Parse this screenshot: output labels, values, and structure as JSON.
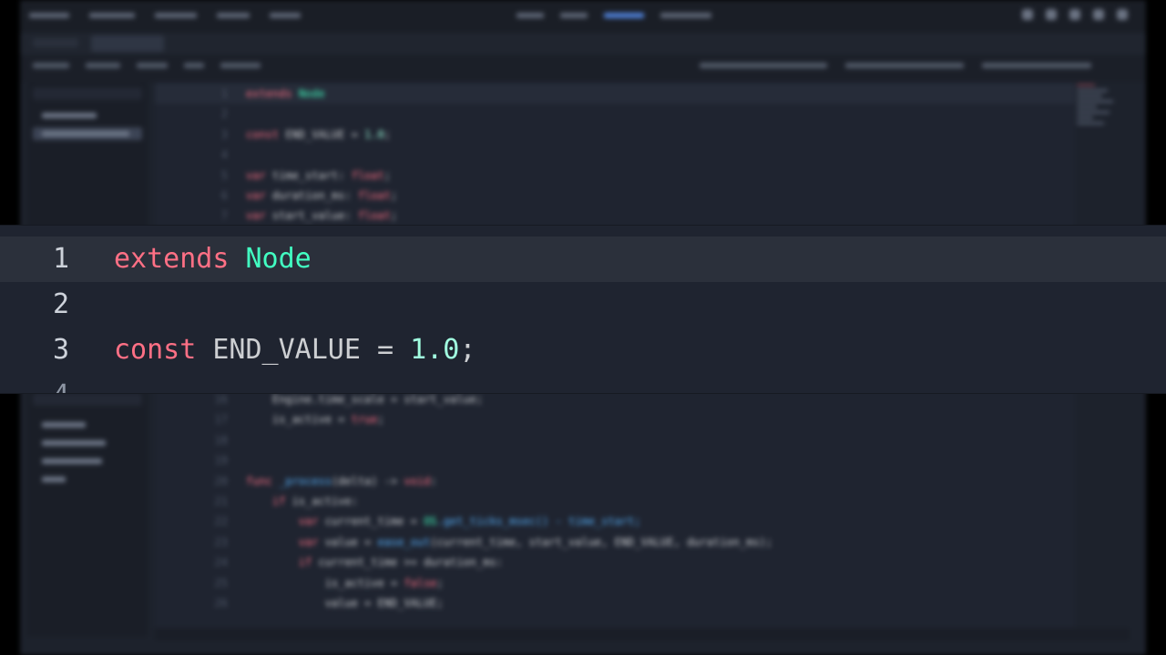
{
  "colors": {
    "editor_bg": "#1f2430",
    "current_line": "#2b303b",
    "keyword": "#ff7085",
    "type": "#42ffc2",
    "identifier": "#cdcfd2",
    "number": "#a1ffe0"
  },
  "zoom": {
    "lines": [
      {
        "num": "1",
        "tokens": [
          {
            "t": "extends",
            "c": "kw"
          },
          {
            "t": " ",
            "c": "id"
          },
          {
            "t": "Node",
            "c": "ty"
          }
        ],
        "current": true
      },
      {
        "num": "2",
        "tokens": [],
        "current": false
      },
      {
        "num": "3",
        "tokens": [
          {
            "t": "const",
            "c": "kw"
          },
          {
            "t": " END_VALUE = ",
            "c": "id"
          },
          {
            "t": "1.0",
            "c": "num"
          },
          {
            "t": ";",
            "c": "id"
          }
        ],
        "current": false
      },
      {
        "num": "4",
        "tokens": [],
        "current": false,
        "cut": true
      }
    ]
  },
  "background": {
    "code_lines_top": [
      {
        "num": "1",
        "tokens": [
          {
            "t": "extends",
            "c": "kw"
          },
          {
            "t": " ",
            "c": "id"
          },
          {
            "t": "Node",
            "c": "ty"
          }
        ],
        "current": true
      },
      {
        "num": "2",
        "tokens": []
      },
      {
        "num": "3",
        "tokens": [
          {
            "t": "const",
            "c": "kw"
          },
          {
            "t": " END_VALUE = ",
            "c": "id"
          },
          {
            "t": "1.0",
            "c": "num"
          },
          {
            "t": ";",
            "c": "id"
          }
        ]
      },
      {
        "num": "4",
        "tokens": []
      },
      {
        "num": "5",
        "tokens": [
          {
            "t": "var",
            "c": "kw"
          },
          {
            "t": " time_start: ",
            "c": "id"
          },
          {
            "t": "float",
            "c": "kw"
          },
          {
            "t": ";",
            "c": "id"
          }
        ]
      },
      {
        "num": "6",
        "tokens": [
          {
            "t": "var",
            "c": "kw"
          },
          {
            "t": " duration_ms: ",
            "c": "id"
          },
          {
            "t": "float",
            "c": "kw"
          },
          {
            "t": ";",
            "c": "id"
          }
        ]
      },
      {
        "num": "7",
        "tokens": [
          {
            "t": "var",
            "c": "kw"
          },
          {
            "t": " start_value: ",
            "c": "id"
          },
          {
            "t": "float",
            "c": "kw"
          },
          {
            "t": ";",
            "c": "id"
          }
        ]
      }
    ],
    "code_lines_bottom": [
      {
        "num": "16",
        "tokens": [
          {
            "t": "\t",
            "c": "id"
          },
          {
            "t": "Engine.time_scale = start_value;",
            "c": "id"
          }
        ]
      },
      {
        "num": "17",
        "tokens": [
          {
            "t": "\t",
            "c": "id"
          },
          {
            "t": "is_active = ",
            "c": "id"
          },
          {
            "t": "true",
            "c": "kw"
          },
          {
            "t": ";",
            "c": "id"
          }
        ]
      },
      {
        "num": "18",
        "tokens": []
      },
      {
        "num": "19",
        "tokens": []
      },
      {
        "num": "20",
        "tokens": [
          {
            "t": "func",
            "c": "kw"
          },
          {
            "t": " _process",
            "c": "fn"
          },
          {
            "t": "(delta) -> ",
            "c": "id"
          },
          {
            "t": "void",
            "c": "kw"
          },
          {
            "t": ":",
            "c": "id"
          }
        ]
      },
      {
        "num": "21",
        "tokens": [
          {
            "t": "\t",
            "c": "id"
          },
          {
            "t": "if",
            "c": "kw"
          },
          {
            "t": " is_active:",
            "c": "id"
          }
        ]
      },
      {
        "num": "22",
        "tokens": [
          {
            "t": "\t\t",
            "c": "id"
          },
          {
            "t": "var",
            "c": "kw"
          },
          {
            "t": " current_time = ",
            "c": "id"
          },
          {
            "t": "OS",
            "c": "ty"
          },
          {
            "t": ".get_ticks_msec() - time_start;",
            "c": "fn"
          }
        ]
      },
      {
        "num": "23",
        "tokens": [
          {
            "t": "\t\t",
            "c": "id"
          },
          {
            "t": "var",
            "c": "kw"
          },
          {
            "t": " value = ",
            "c": "id"
          },
          {
            "t": "ease_out",
            "c": "fn"
          },
          {
            "t": "(current_time, start_value, END_VALUE, duration_ms);",
            "c": "id"
          }
        ]
      },
      {
        "num": "24",
        "tokens": [
          {
            "t": "\t\t",
            "c": "id"
          },
          {
            "t": "if",
            "c": "kw"
          },
          {
            "t": " current_time >= duration_ms:",
            "c": "id"
          }
        ]
      },
      {
        "num": "25",
        "tokens": [
          {
            "t": "\t\t\t",
            "c": "id"
          },
          {
            "t": "is_active = ",
            "c": "id"
          },
          {
            "t": "false",
            "c": "kw"
          },
          {
            "t": ";",
            "c": "id"
          }
        ]
      },
      {
        "num": "26",
        "tokens": [
          {
            "t": "\t\t\t",
            "c": "id"
          },
          {
            "t": "value = END_VALUE;",
            "c": "id"
          }
        ]
      }
    ]
  }
}
